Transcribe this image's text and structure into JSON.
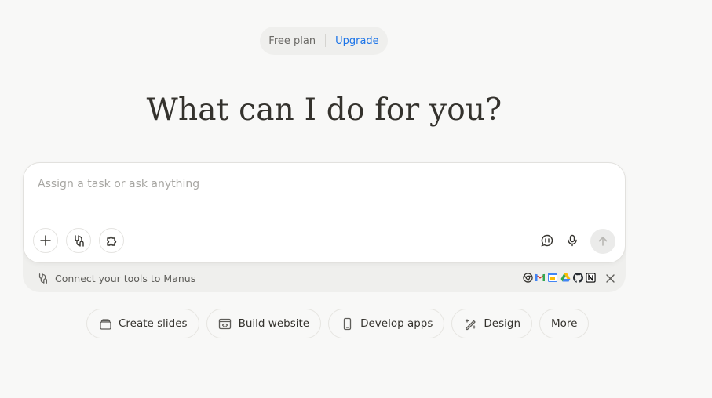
{
  "plan": {
    "current": "Free plan",
    "upgrade_label": "Upgrade"
  },
  "hero": {
    "title": "What can I do for you?"
  },
  "composer": {
    "placeholder": "Assign a task or ask anything",
    "value": "",
    "left_tools": [
      "plus-icon",
      "connector-icon",
      "puzzle-icon"
    ],
    "right_tools": [
      "chat-mode-icon",
      "microphone-icon"
    ],
    "send_icon": "arrow-up-icon"
  },
  "connect": {
    "label": "Connect your tools to Manus",
    "apps": [
      "chrome-icon",
      "gmail-icon",
      "google-calendar-icon",
      "google-drive-icon",
      "github-icon",
      "notion-icon"
    ]
  },
  "quick_actions": [
    {
      "label": "Create slides",
      "icon": "slides-icon"
    },
    {
      "label": "Build website",
      "icon": "website-icon"
    },
    {
      "label": "Develop apps",
      "icon": "phone-icon"
    },
    {
      "label": "Design",
      "icon": "design-icon"
    },
    {
      "label": "More",
      "icon": ""
    }
  ],
  "colors": {
    "background": "#f8f8f7",
    "text": "#34322d",
    "accent_link": "#1a73e8",
    "placeholder": "#a7a6a2"
  }
}
